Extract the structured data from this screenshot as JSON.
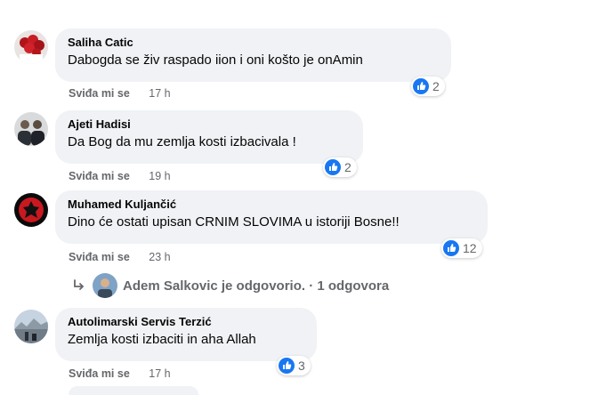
{
  "comments": [
    {
      "author": "Saliha Catic",
      "text": "Dabogda se živ raspado iion i oni košto je onAmin",
      "reaction_count": "2",
      "like_label": "Sviđa mi se",
      "time": "17 h"
    },
    {
      "author": "Ajeti Hadisi",
      "text": "Da Bog da mu zemlja kosti izbacivala !",
      "reaction_count": "2",
      "like_label": "Sviđa mi se",
      "time": "19 h"
    },
    {
      "author": "Muhamed Kuljančić",
      "text": "Dino će ostati upisan CRNIM SLOVIMA u istoriji Bosne!!",
      "reaction_count": "12",
      "like_label": "Sviđa mi se",
      "time": "23 h"
    },
    {
      "author": "Autolimarski Servis Terzić",
      "text": "Zemlja kosti izbaciti in aha Allah",
      "reaction_count": "3",
      "like_label": "Sviđa mi se",
      "time": "17 h"
    }
  ],
  "reply": {
    "text": "Adem Salkovic je odgovorio. · 1 odgovora"
  },
  "colors": {
    "bubble": "#f0f2f5",
    "like_blue": "#1877f2",
    "meta_gray": "#65676b",
    "text": "#050505"
  },
  "icons": {
    "like": "thumbs-up-icon",
    "reply": "reply-arrow-icon"
  }
}
